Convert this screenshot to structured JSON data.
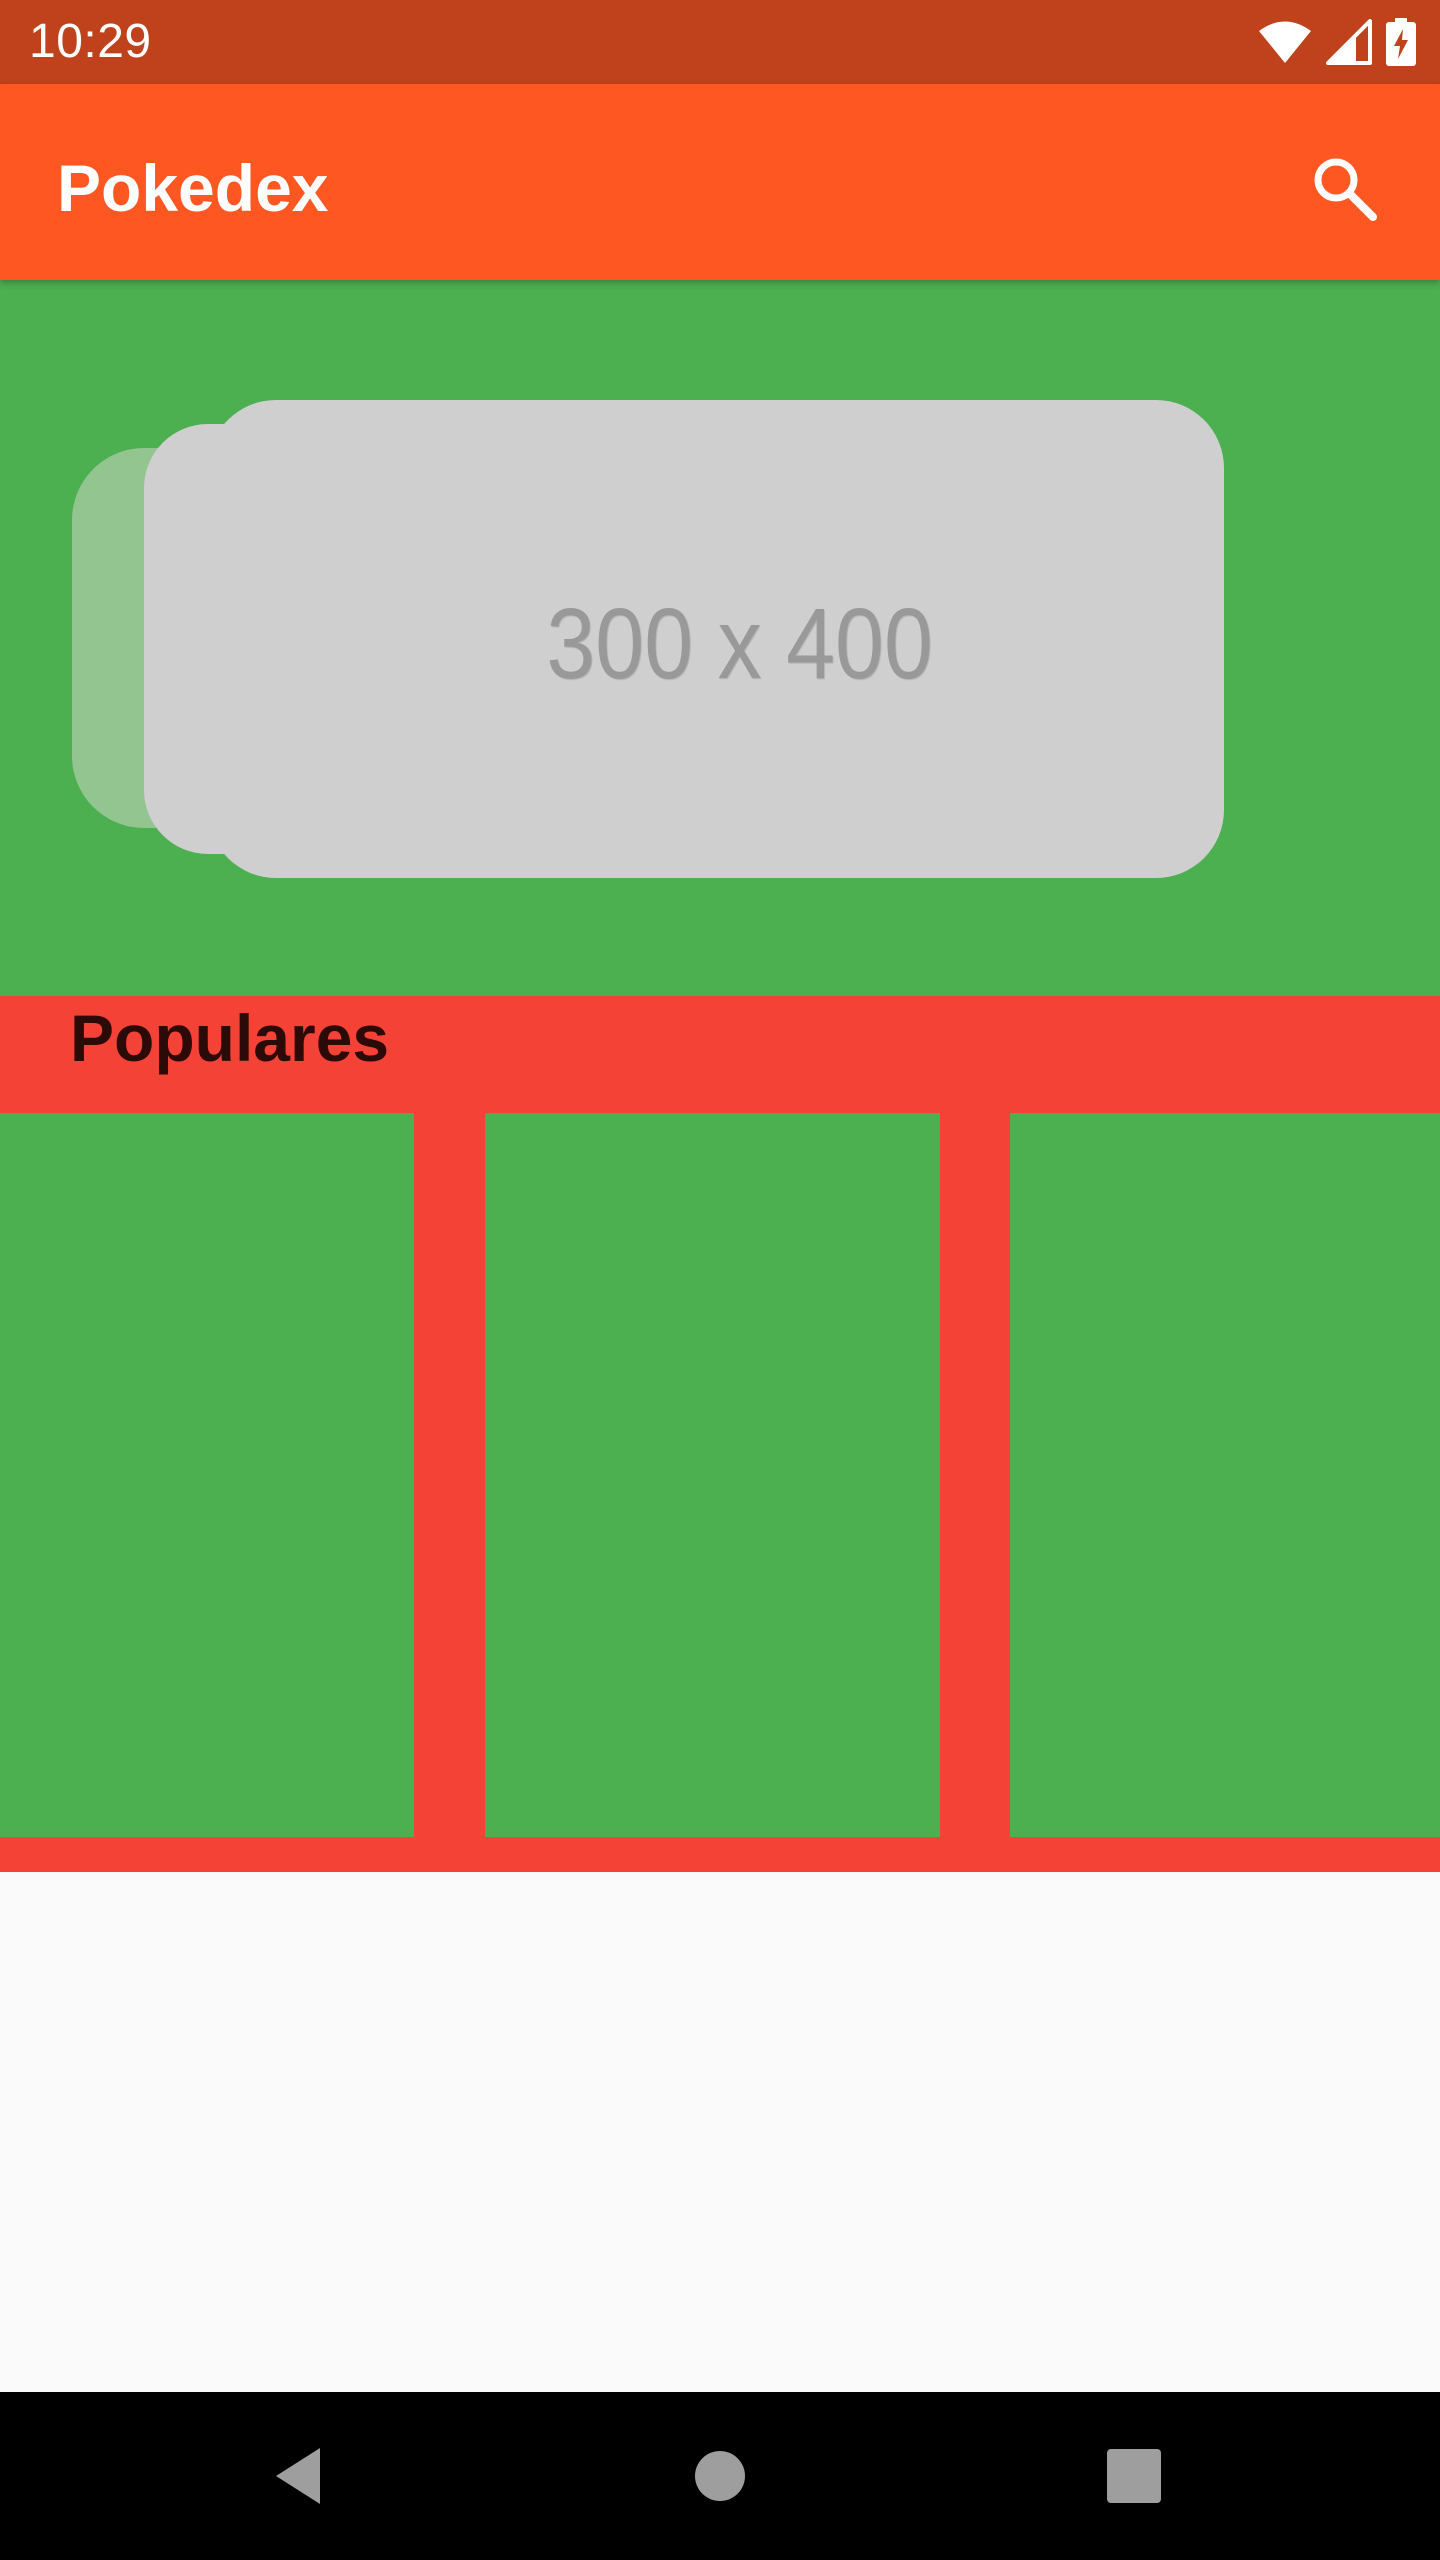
{
  "status_bar": {
    "time": "10:29",
    "icons": [
      "wifi-icon",
      "cell-signal-icon",
      "battery-charging-icon"
    ],
    "background": "#BF421C"
  },
  "app_bar": {
    "title": "Pokedex",
    "search_icon": "search-icon",
    "background": "#FF5722"
  },
  "carousel": {
    "placeholder_label": "300 x 400",
    "background": "#4CAF50"
  },
  "populares": {
    "title": "Populares",
    "background": "#F44336",
    "item_count": 3
  },
  "nav_bar": {
    "buttons": [
      "back-icon",
      "home-icon",
      "recents-icon"
    ]
  }
}
